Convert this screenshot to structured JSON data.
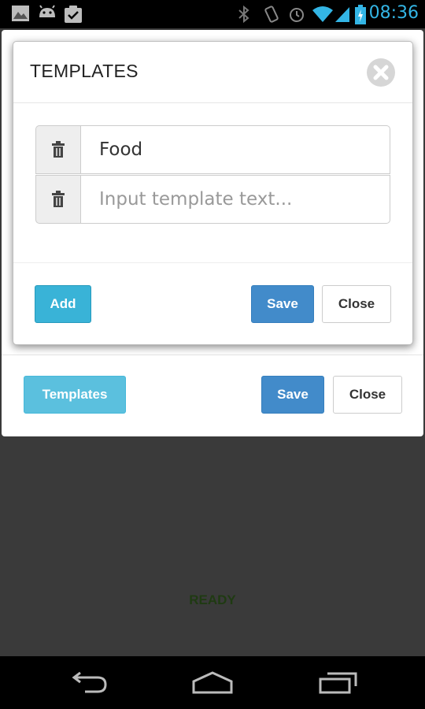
{
  "status_bar": {
    "time": "08:36",
    "left_icons": [
      "image-icon",
      "android-icon",
      "task-check-icon"
    ],
    "right_icons": [
      "bluetooth-icon",
      "vibrate-icon",
      "alarm-icon",
      "wifi-icon",
      "signal-icon",
      "battery-charging-icon"
    ]
  },
  "modal": {
    "title": "TEMPLATES",
    "close_icon": "close-circle-icon",
    "templates": [
      {
        "value": "Food",
        "placeholder": ""
      },
      {
        "value": "",
        "placeholder": "Input template text..."
      }
    ],
    "add_label": "Add",
    "save_label": "Save",
    "close_label": "Close"
  },
  "outer_dialog": {
    "templates_label": "Templates",
    "save_label": "Save",
    "close_label": "Close"
  },
  "status_text": "READY",
  "colors": {
    "accent_blue": "#33b5e5",
    "btn_info": "#39b3d7",
    "btn_primary": "#428bca",
    "ready_text": "#1f3a12"
  }
}
